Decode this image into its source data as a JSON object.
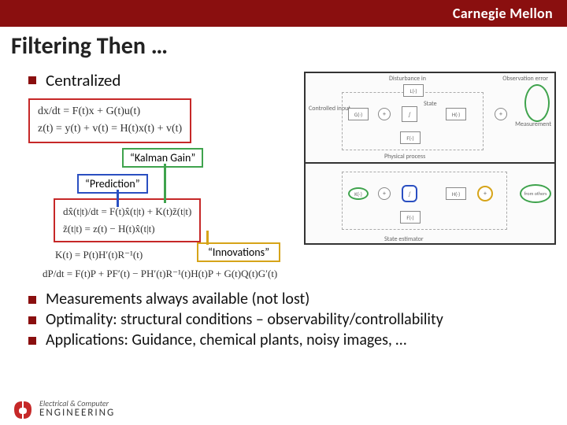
{
  "header": {
    "org": "Carnegie Mellon"
  },
  "title": "Filtering Then …",
  "bullets": {
    "centralized": "Centralized",
    "b1": "Measurements always available (not lost)",
    "b2": "Optimality: structural conditions – observability/controllability",
    "b3": "Applications: Guidance, chemical plants, noisy images, …"
  },
  "labels": {
    "kalman_gain": "“Kalman Gain”",
    "prediction": "“Prediction”",
    "innovations": "“Innovations”"
  },
  "eq": {
    "sys1": "dx/dt = F(t)x + G(t)u(t)",
    "sys2": "z(t) = y(t) + v(t) = H(t)x(t) + v(t)",
    "est1": "dx̂(t|t)/dt = F(t)x̂(t|t) + K(t)z̃(t|t)",
    "est2": "z̃(t|t) = z(t) − H(t)x̂(t|t)",
    "gain": "K(t) = P(t)H′(t)R⁻¹(t)",
    "ric": "dP/dt = F(t)P + PF′(t) − PH′(t)R⁻¹(t)H(t)P + G(t)Q(t)G′(t)"
  },
  "diagram": {
    "top_labels": {
      "disturbance": "Disturbance in",
      "obs_err": "Observation error",
      "controlled": "Controlled input",
      "meas": "Measurement",
      "phys": "Physical process",
      "state": "State"
    },
    "bot_labels": {
      "est": "State estimator",
      "from": "from others"
    },
    "box": {
      "L": "L(·)",
      "G": "G(·)",
      "H": "H(·)",
      "F": "F(·)",
      "int": "∫",
      "K": "K(·)",
      "Hh": "H(·)",
      "Ff": "F(·)"
    }
  },
  "footer": {
    "dept1": "Electrical & Computer",
    "dept2": "ENGINEERING"
  }
}
